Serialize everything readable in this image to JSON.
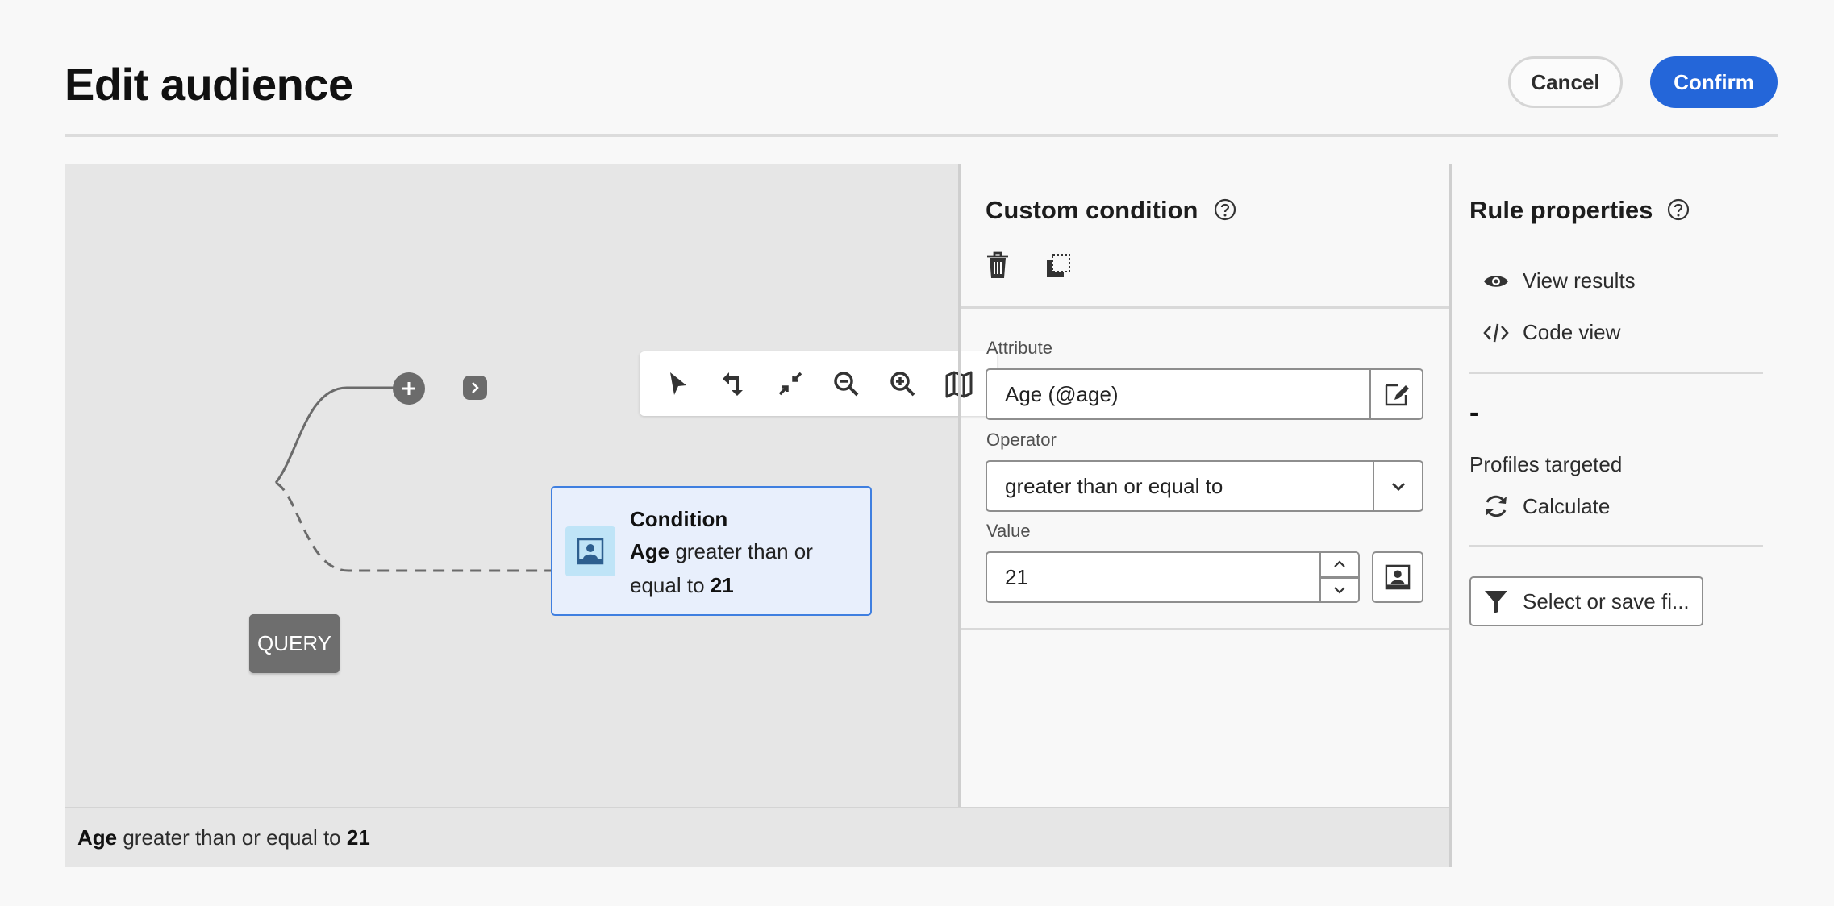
{
  "header": {
    "title": "Edit audience",
    "cancel_label": "Cancel",
    "confirm_label": "Confirm"
  },
  "canvas": {
    "toolbar": [
      "select-icon",
      "undo-icon",
      "collapse-icon",
      "zoom-out-icon",
      "zoom-in-icon",
      "map-icon"
    ],
    "query_node_label": "QUERY",
    "condition_node": {
      "title": "Condition",
      "attr": "Age",
      "op_line1": " greater than or",
      "op_line2": "equal to ",
      "value": "21"
    }
  },
  "summary": {
    "attr": "Age",
    "op": " greater than or equal to ",
    "value": "21"
  },
  "custom_condition": {
    "title": "Custom condition",
    "attribute_label": "Attribute",
    "attribute_value": "Age (@age)",
    "operator_label": "Operator",
    "operator_value": "greater than or equal to",
    "value_label": "Value",
    "value": "21"
  },
  "rule_properties": {
    "title": "Rule properties",
    "view_results": "View results",
    "code_view": "Code view",
    "profiles_count": "-",
    "profiles_label": "Profiles targeted",
    "calculate": "Calculate",
    "select_filter": "Select or save fi..."
  },
  "colors": {
    "accent": "#2466d9",
    "canvas_bg": "#e6e6e6",
    "node_gray": "#6e6e6e",
    "condition_bg": "#e8effc",
    "condition_border": "#3f7fe0"
  }
}
